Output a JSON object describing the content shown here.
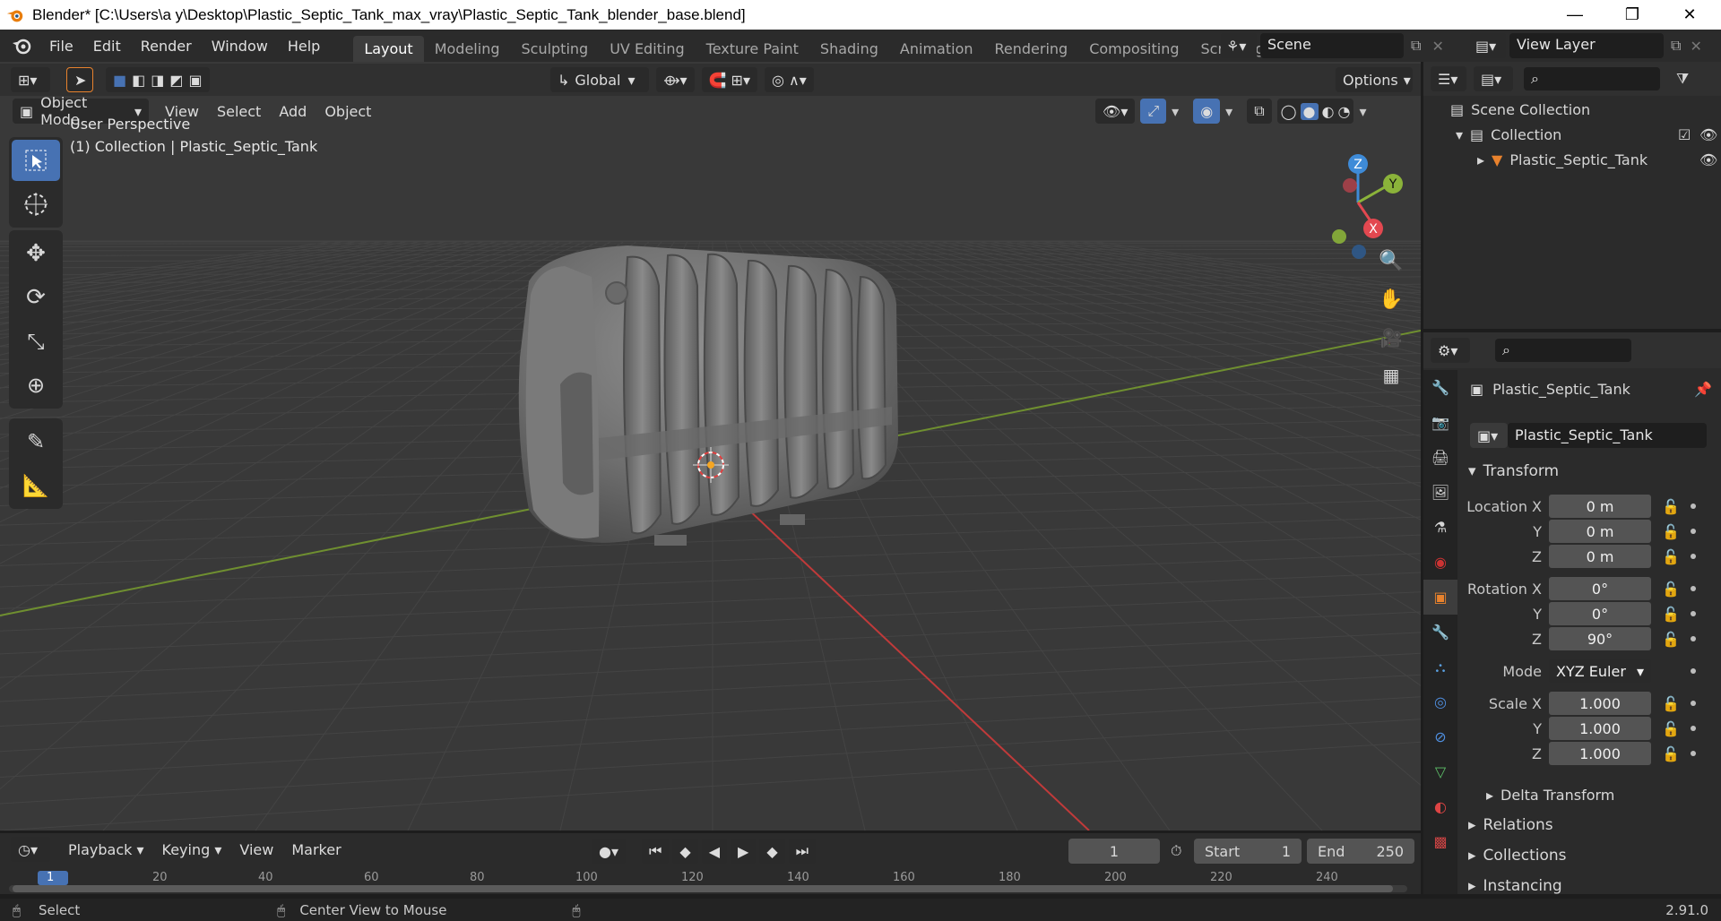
{
  "window": {
    "title": "Blender* [C:\\Users\\a y\\Desktop\\Plastic_Septic_Tank_max_vray\\Plastic_Septic_Tank_blender_base.blend]",
    "minimize": "—",
    "maximize": "❐",
    "close": "✕"
  },
  "menu": [
    "File",
    "Edit",
    "Render",
    "Window",
    "Help"
  ],
  "workspaces": [
    "Layout",
    "Modeling",
    "Sculpting",
    "UV Editing",
    "Texture Paint",
    "Shading",
    "Animation",
    "Rendering",
    "Compositing",
    "Scripting"
  ],
  "active_workspace": "Layout",
  "add_workspace": "+",
  "scene": {
    "name": "Scene"
  },
  "view_layer": {
    "name": "View Layer"
  },
  "viewport": {
    "mode": "Object Mode",
    "menus": [
      "View",
      "Select",
      "Add",
      "Object"
    ],
    "orientation": "Global",
    "options": "Options",
    "overlay_line1": "User Perspective",
    "overlay_line2": "(1) Collection | Plastic_Septic_Tank",
    "gizmo": {
      "x": "X",
      "y": "Y",
      "z": "Z"
    }
  },
  "outliner": {
    "scene_collection": "Scene Collection",
    "collection": "Collection",
    "object": "Plastic_Septic_Tank"
  },
  "properties": {
    "object_name": "Plastic_Septic_Tank",
    "datablock_name": "Plastic_Septic_Tank",
    "transform_title": "Transform",
    "location_label": "Location X",
    "loc": [
      "0 m",
      "0 m",
      "0 m"
    ],
    "rotation_label": "Rotation X",
    "rot": [
      "0°",
      "0°",
      "90°"
    ],
    "mode_label": "Mode",
    "mode_value": "XYZ Euler",
    "scale_label": "Scale X",
    "scale": [
      "1.000",
      "1.000",
      "1.000"
    ],
    "axis_y": "Y",
    "axis_z": "Z",
    "delta": "Delta Transform",
    "relations": "Relations",
    "collections": "Collections",
    "instancing": "Instancing"
  },
  "timeline": {
    "menus": [
      "Playback",
      "Keying",
      "View",
      "Marker"
    ],
    "current_frame": "1",
    "start_label": "Start",
    "start": "1",
    "end_label": "End",
    "end": "250",
    "ruler": [
      "1",
      "20",
      "40",
      "60",
      "80",
      "100",
      "120",
      "140",
      "160",
      "180",
      "200",
      "220",
      "240"
    ]
  },
  "status": {
    "left": "Select",
    "middle": "Center View to Mouse",
    "version": "2.91.0"
  },
  "colors": {
    "accent": "#4772b3",
    "x_axis": "#e34850",
    "y_axis": "#8bb33a",
    "z_axis": "#3e8bd8",
    "object_orange": "#e8822d"
  }
}
